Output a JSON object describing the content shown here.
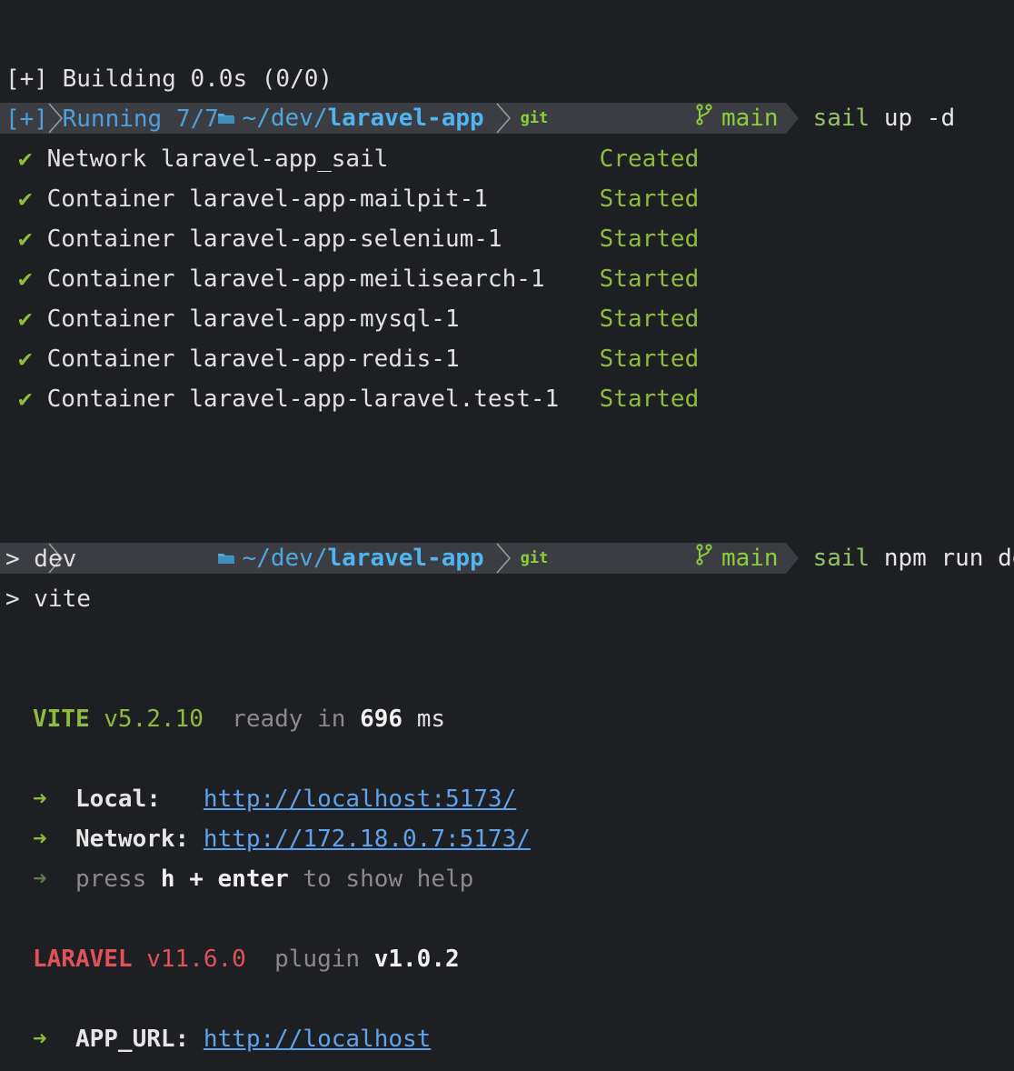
{
  "prompts": [
    {
      "path_tilde": "~",
      "path_mid": "/dev/",
      "path_last": "laravel-app",
      "git_label": "git",
      "branch": "main",
      "command_name": "sail",
      "command_args": " up -d"
    },
    {
      "path_tilde": "~",
      "path_mid": "/dev/",
      "path_last": "laravel-app",
      "git_label": "git",
      "branch": "main",
      "command_name": "sail",
      "command_args": " npm run dev"
    }
  ],
  "compose": {
    "building": "[+] Building 0.0s (0/0)",
    "running": "[+] Running 7/7",
    "check": "✔",
    "items": [
      {
        "resource": "Network laravel-app_sail",
        "status": "Created"
      },
      {
        "resource": "Container laravel-app-mailpit-1",
        "status": "Started"
      },
      {
        "resource": "Container laravel-app-selenium-1",
        "status": "Started"
      },
      {
        "resource": "Container laravel-app-meilisearch-1",
        "status": "Started"
      },
      {
        "resource": "Container laravel-app-mysql-1",
        "status": "Started"
      },
      {
        "resource": "Container laravel-app-redis-1",
        "status": "Started"
      },
      {
        "resource": "Container laravel-app-laravel.test-1",
        "status": "Started"
      }
    ]
  },
  "npm": {
    "script_line": "> dev",
    "vite_line": "> vite"
  },
  "vite": {
    "name": "VITE",
    "version": "v5.2.10",
    "ready_text": "ready in",
    "ready_ms": "696",
    "ms_unit": "ms",
    "arrow": "➜",
    "local_label": "Local:",
    "local_url": "http://localhost:5173/",
    "network_label": "Network:",
    "network_url": "http://172.18.0.7:5173/",
    "help_press": "press",
    "help_key": "h + enter",
    "help_rest": "to show help"
  },
  "laravel": {
    "name": "LARAVEL",
    "version": "v11.6.0",
    "plugin_label": "plugin",
    "plugin_version": "v1.0.2",
    "app_url_label": "APP_URL:",
    "app_url": "http://localhost"
  },
  "colors": {
    "background": "#1e1f22",
    "prompt_segment": "#3b3d42",
    "green": "#8fbb3d",
    "blue": "#4f9fdd",
    "red": "#e0525a",
    "link": "#5fa3ec"
  },
  "icons": [
    "apple-icon",
    "folder-icon",
    "git-icon",
    "branch-icon",
    "check-icon",
    "arrow-icon"
  ]
}
